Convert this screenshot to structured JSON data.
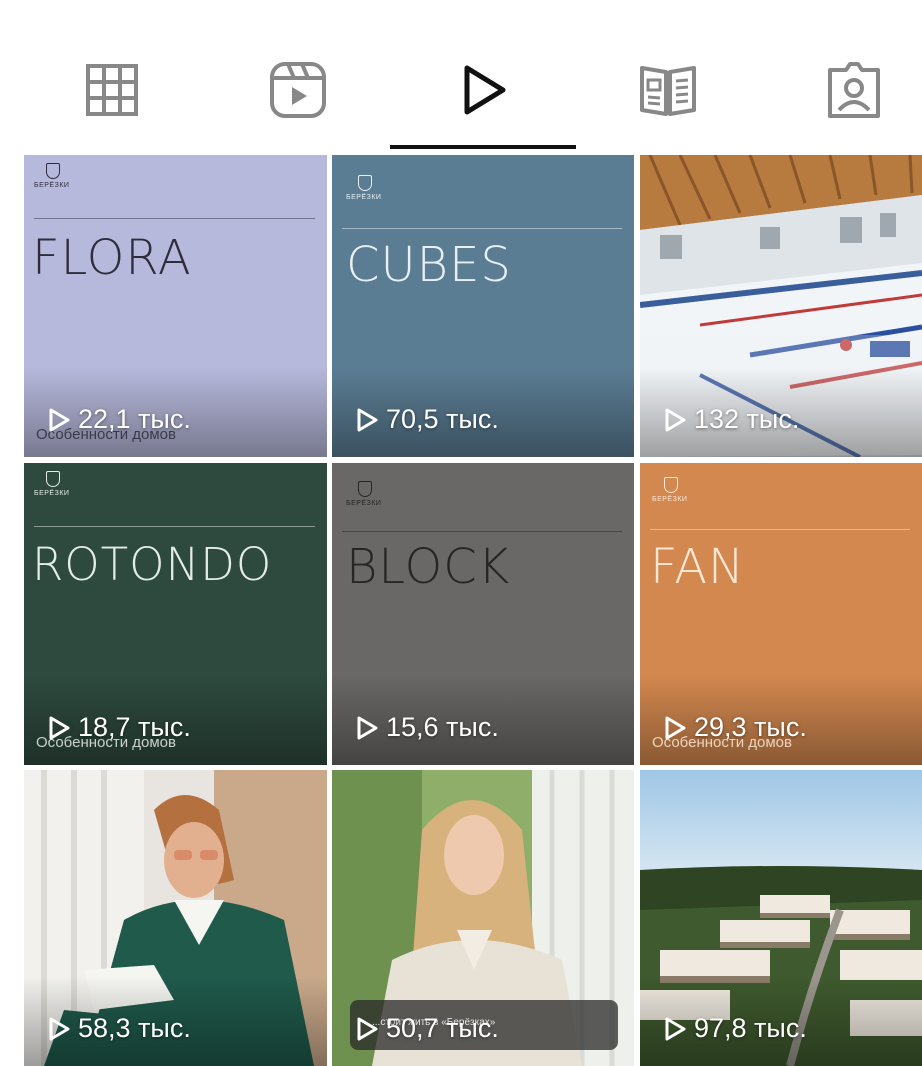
{
  "tabs": [
    {
      "icon": "grid-icon",
      "active": false
    },
    {
      "icon": "reels-icon",
      "active": false
    },
    {
      "icon": "play-icon",
      "active": true
    },
    {
      "icon": "guides-icon",
      "active": false
    },
    {
      "icon": "tagged-icon",
      "active": false
    }
  ],
  "tiles": [
    {
      "kind": "card",
      "bg": "#b7b9dc",
      "fg": "#2d2d3b",
      "brand": "БЕРЁЗКИ",
      "title": "FLORA",
      "caption": "Особенности домов",
      "views": "22,1 тыс."
    },
    {
      "kind": "card",
      "bg": "#5b7d94",
      "fg": "#e9f0f5",
      "brand": "БЕРЁЗКИ",
      "title": "CUBES",
      "caption": "",
      "views": "70,5 тыс."
    },
    {
      "kind": "photo",
      "scene": "ice-arena",
      "views": "132 тыс."
    },
    {
      "kind": "card",
      "bg": "#2e4a3e",
      "fg": "#e4ece7",
      "brand": "БЕРЁЗКИ",
      "title": "ROTONDO",
      "caption": "Особенности домов",
      "views": "18,7 тыс."
    },
    {
      "kind": "card",
      "bg": "#6a6866",
      "fg": "#262626",
      "brand": "БЕРЁЗКИ",
      "title": "BLOCK",
      "caption": "",
      "views": "15,6 тыс."
    },
    {
      "kind": "card",
      "bg": "#d3884f",
      "fg": "#fbe7d3",
      "brand": "БЕРЁЗКИ",
      "title": "FAN",
      "caption": "Особенности домов",
      "views": "29,3 тыс."
    },
    {
      "kind": "photo",
      "scene": "woman-green-sweater",
      "views": "58,3 тыс."
    },
    {
      "kind": "photo",
      "scene": "woman-interview",
      "subtitle": "...стоит жить в «Берёзках»",
      "views": "50,7 тыс."
    },
    {
      "kind": "photo",
      "scene": "aerial-houses",
      "views": "97,8 тыс."
    }
  ]
}
